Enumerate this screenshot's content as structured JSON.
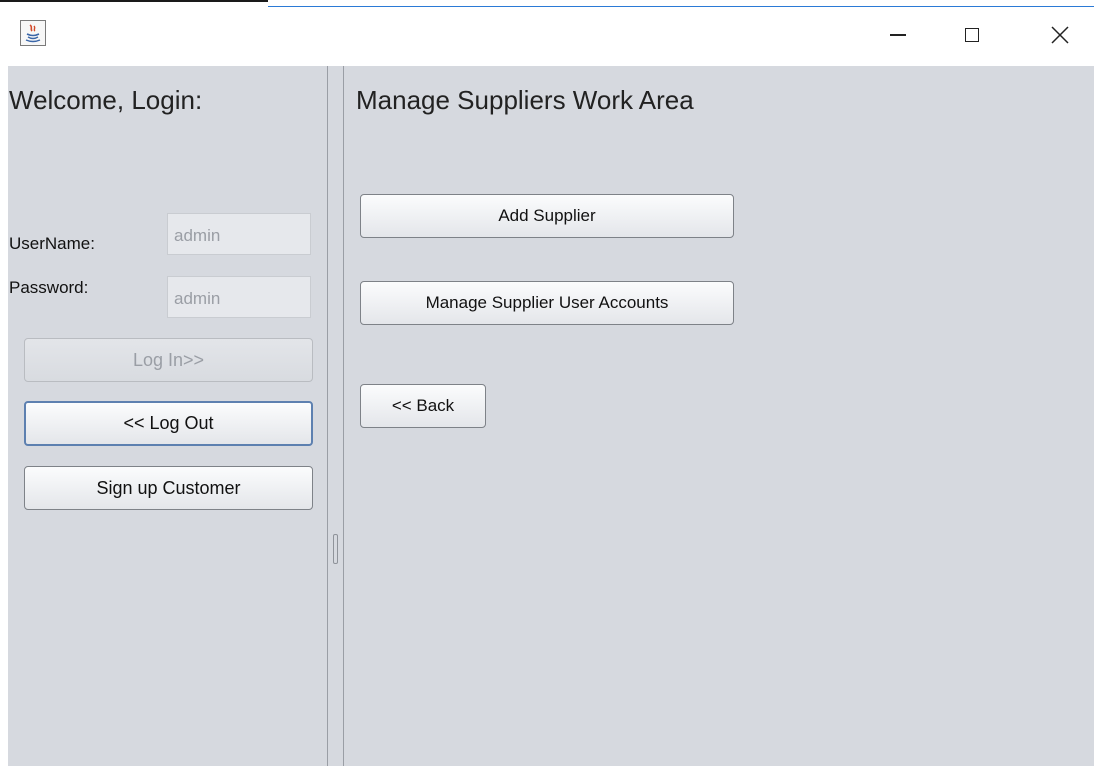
{
  "window": {
    "title": "",
    "controls": {
      "minimize": "minimize-icon",
      "maximize": "maximize-icon",
      "close": "close-icon"
    }
  },
  "login_panel": {
    "heading": "Welcome, Login:",
    "username_label": "UserName:",
    "username_value": "admin",
    "password_label": "Password:",
    "password_value": "admin",
    "login_button": "Log In>>",
    "logout_button": "<< Log Out",
    "signup_button": "Sign up Customer"
  },
  "work_area": {
    "heading": "Manage Suppliers Work Area",
    "add_supplier_button": "Add Supplier",
    "manage_accounts_button": "Manage Supplier User Accounts",
    "back_button": "<< Back"
  },
  "colors": {
    "panel_bg": "#d6d9df",
    "focus_border": "#5d80b0",
    "title_accent": "#2b7ad6"
  }
}
